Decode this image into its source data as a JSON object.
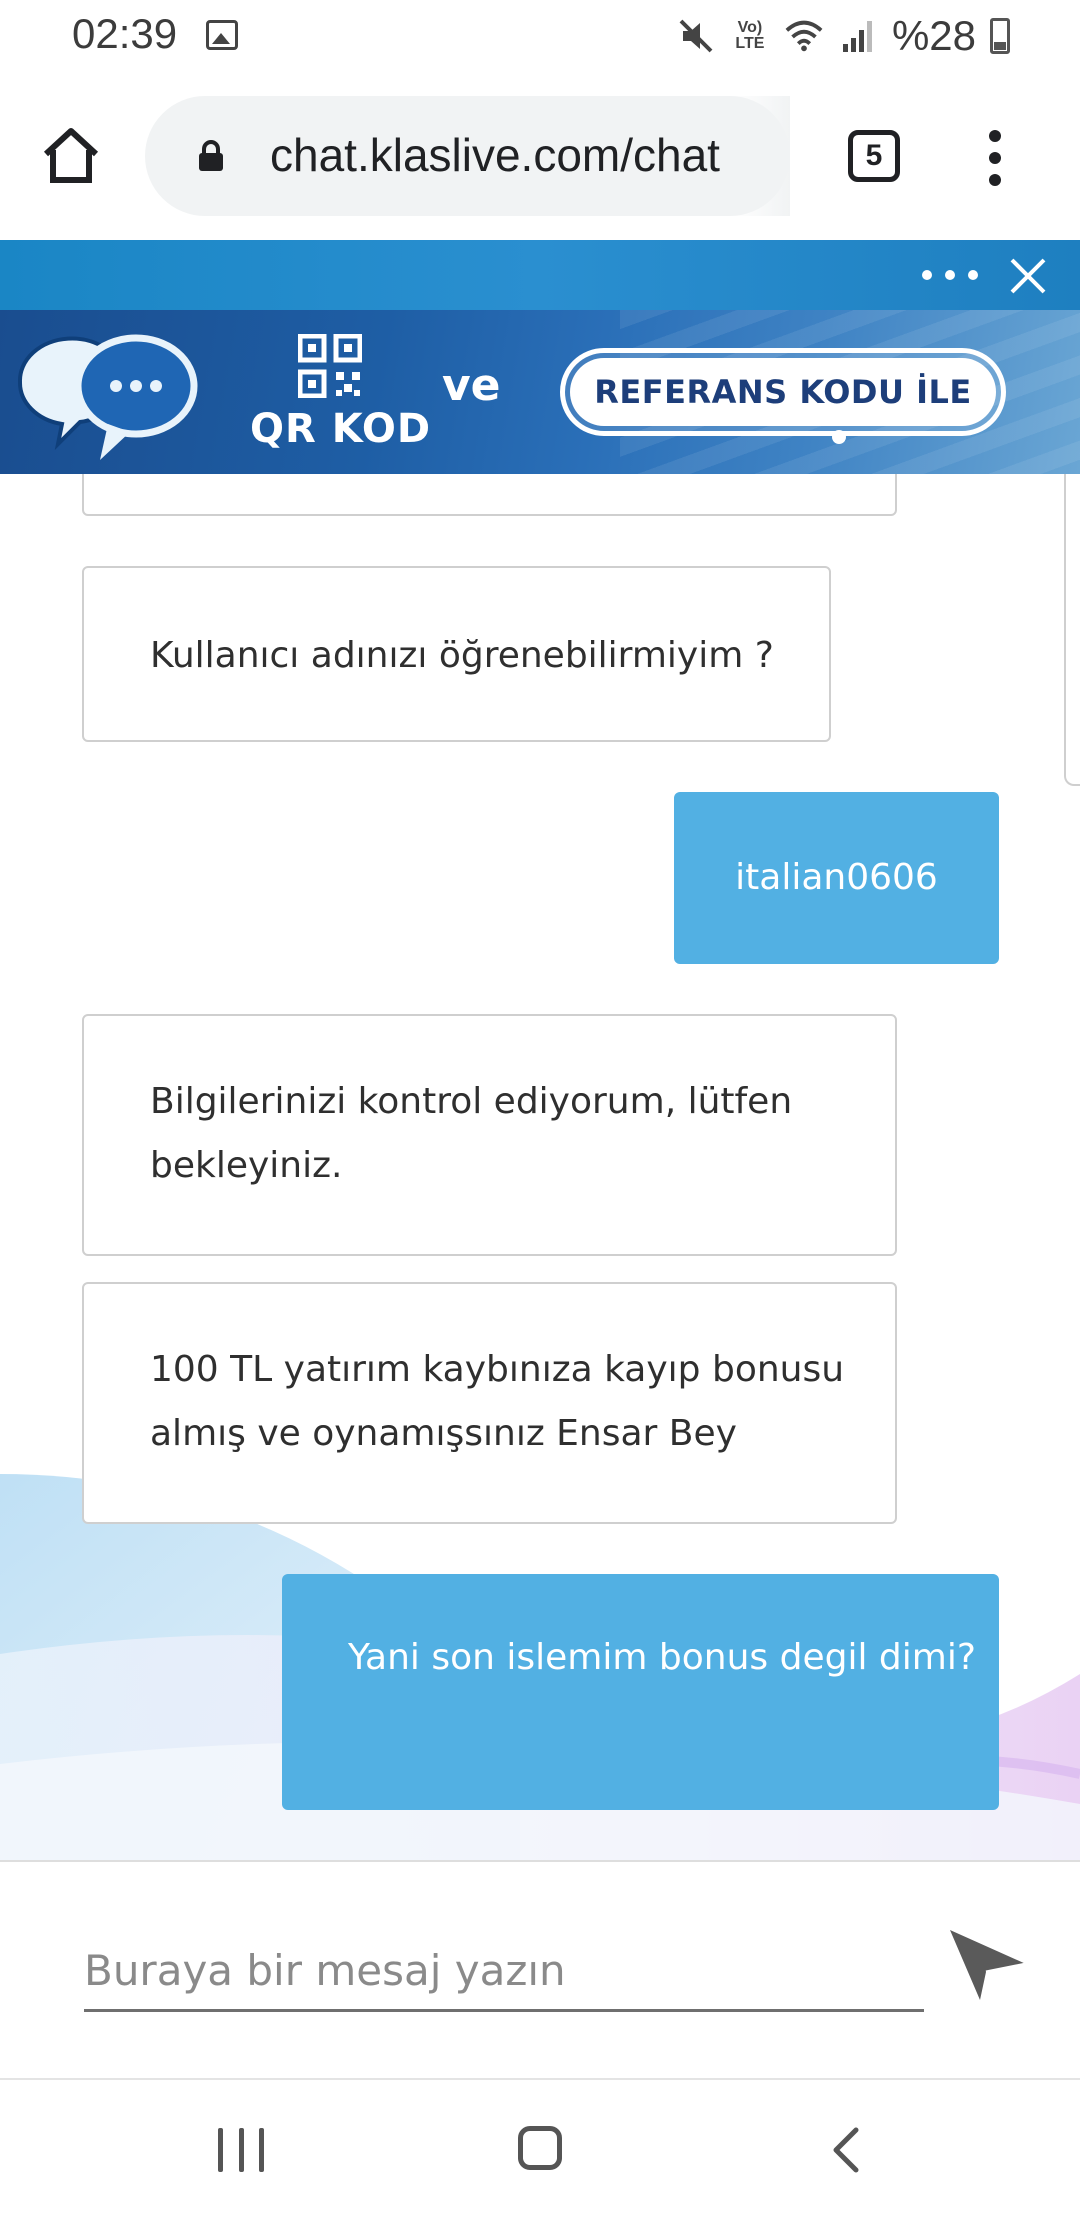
{
  "status_bar": {
    "time": "02:39",
    "battery": "%28",
    "volte": [
      "Vo)",
      "LTE"
    ],
    "icons": [
      "image-icon",
      "mute-icon",
      "volte-icon",
      "wifi-icon",
      "signal-icon",
      "battery-icon"
    ]
  },
  "browser": {
    "url": "chat.klaslive.com/chat",
    "tab_count": "5"
  },
  "banner": {
    "qr_text": "QR KOD",
    "and_text": "ve",
    "referral_button": "REFERANS KODU İLE"
  },
  "chat": {
    "messages": [
      {
        "from": "agent",
        "text": ""
      },
      {
        "from": "agent",
        "text": "Kullanıcı adınızı öğrenebilirmiyim ?"
      },
      {
        "from": "user",
        "text": "italian0606"
      },
      {
        "from": "agent",
        "text": "Bilgilerinizi kontrol ediyorum, lütfen bekleyiniz."
      },
      {
        "from": "agent",
        "text": "100 TL yatırım kaybınıza kayıp bonusu almış ve oynamışsınız Ensar Bey"
      },
      {
        "from": "user",
        "text": "Yani son islemim bonus degil dimi?"
      }
    ]
  },
  "composer": {
    "placeholder": "Buraya bir mesaj yazın",
    "value": ""
  },
  "colors": {
    "header_blue": "#1a86c5",
    "user_bubble": "#52b0e3",
    "banner_dark": "#1a4d8f"
  }
}
